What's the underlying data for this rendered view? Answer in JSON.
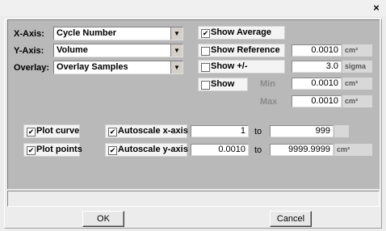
{
  "window": {
    "close_glyph": "×"
  },
  "axes": {
    "x": {
      "label": "X-Axis:",
      "value": "Cycle Number"
    },
    "y": {
      "label": "Y-Axis:",
      "value": "Volume"
    },
    "overlay": {
      "label": "Overlay:",
      "value": "Overlay Samples"
    }
  },
  "options": {
    "show_average": {
      "label": "Show Average",
      "checked": true
    },
    "show_reference": {
      "label": "Show Reference",
      "checked": false,
      "value": "0.0010",
      "unit": "cm³"
    },
    "show_pm": {
      "label": "Show +/-",
      "checked": false,
      "value": "3.0",
      "unit": "sigma"
    },
    "show": {
      "label": "Show",
      "checked": false
    },
    "min": {
      "label": "Min",
      "value": "0.0010",
      "unit": "cm³"
    },
    "max": {
      "label": "Max",
      "value": "0.0010",
      "unit": "cm³"
    }
  },
  "plot": {
    "plot_curve": {
      "label": "Plot curve",
      "checked": true
    },
    "plot_points": {
      "label": "Plot points",
      "checked": true
    },
    "autoscale_x": {
      "label": "Autoscale x-axis",
      "checked": true,
      "from": "1",
      "to_label": "to",
      "to": "999",
      "unit": ""
    },
    "autoscale_y": {
      "label": "Autoscale y-axis",
      "checked": true,
      "from": "0.0010",
      "to_label": "to",
      "to": "9999.9999",
      "unit": "cm³"
    }
  },
  "status_text": "",
  "buttons": {
    "ok": "OK",
    "cancel": "Cancel"
  },
  "icons": {
    "check": "✔",
    "dropdown": "chevron-down-icon"
  },
  "colors": {
    "panel": "#b9b9b9",
    "background": "#ececec"
  }
}
